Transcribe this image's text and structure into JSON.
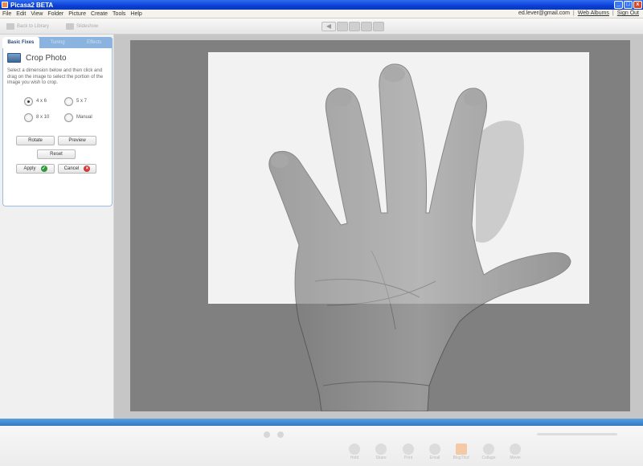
{
  "window": {
    "title": "Picasa2 BETA",
    "minimize": "_",
    "maximize": "□",
    "close": "x"
  },
  "menu": [
    "File",
    "Edit",
    "View",
    "Folder",
    "Picture",
    "Create",
    "Tools",
    "Help"
  ],
  "account": {
    "email": "ed.lever@gmail.com",
    "web_albums": "Web Albums",
    "sign_out": "Sign Out"
  },
  "toolbar": {
    "back_label": "Back to Library",
    "slideshow_label": "Slideshow"
  },
  "tabs": [
    "Basic Fixes",
    "Tuning",
    "Effects"
  ],
  "crop": {
    "title": "Crop Photo",
    "instructions": "Select a dimension below and then click and drag on the image to select the portion of the image you wish to crop.",
    "options": [
      {
        "label": "4 x 6",
        "checked": true
      },
      {
        "label": "5 x 7",
        "checked": false
      },
      {
        "label": "8 x 10",
        "checked": false
      },
      {
        "label": "Manual",
        "checked": false
      }
    ],
    "rotate": "Rotate",
    "preview": "Preview",
    "reset": "Reset",
    "apply": "Apply",
    "cancel": "Cancel"
  },
  "tray": [
    "Hold",
    "Share",
    "Print",
    "Email",
    "BlogThis!",
    "Collage",
    "Movie"
  ],
  "colors": {
    "accent_blue": "#8ab3df",
    "title_bar": "#0a3fd6",
    "apply_ok": "#2e9a3a",
    "cancel_x": "#d23a3a"
  }
}
